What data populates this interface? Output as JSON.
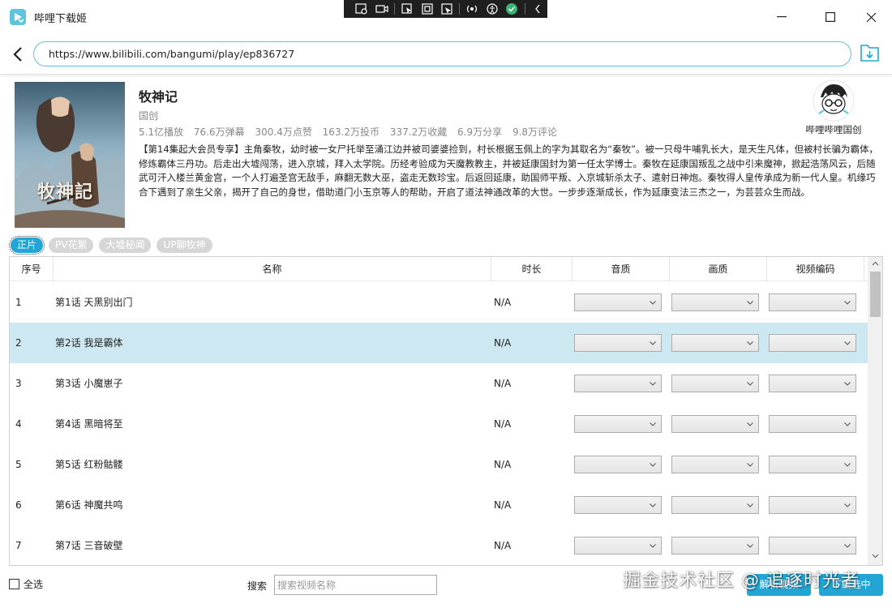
{
  "window": {
    "title": "哔哩下载姬"
  },
  "address": {
    "url": "https://www.bilibili.com/bangumi/play/ep836727"
  },
  "video": {
    "title": "牧神记",
    "type": "国创",
    "stats": [
      "5.1亿播放",
      "76.6万弹幕",
      "300.4万点赞",
      "163.2万投币",
      "337.2万收藏",
      "6.9万分享",
      "9.8万评论"
    ],
    "description": "【第14集起大会员专享】主角秦牧，幼时被一女尸托举至涌江边并被司婆婆捡到，村长根据玉佩上的字为其取名为“秦牧”。被一只母牛哺乳长大，是天生凡体，但被村长骗为霸体，修炼霸体三丹功。后走出大墟闯荡，进入京城，拜入太学院。历经考验成为天魔教教主，并被延康国封为第一任太学博士。秦牧在延康国叛乱之战中引来魔神，掀起浩荡风云，后随武可汗入楼兰黄金宫，一个人打遍圣宫无敌手，麻翻无数大巫，盗走无数珍宝。后返回延康，助国师平叛、入京城斩杀太子、遣射日神炮。秦牧得人皇传承成为新一代人皇。机缘巧合下遇到了亲生父亲，揭开了自己的身世，借助道门小玉京等人的帮助，开启了道法神通改革的大世。一步步逐渐成长，作为延康变法三杰之一，为芸芸众生而战。",
    "cover_text": "牧神記"
  },
  "uploader": {
    "name": "哔哩哔哩国创"
  },
  "tabs": [
    {
      "label": "正片",
      "active": true
    },
    {
      "label": "PV花絮",
      "active": false
    },
    {
      "label": "大墟秘闻",
      "active": false
    },
    {
      "label": "UP聊牧神",
      "active": false
    }
  ],
  "table": {
    "headers": [
      "序号",
      "名称",
      "时长",
      "音质",
      "画质",
      "视频编码"
    ],
    "rows": [
      {
        "no": "1",
        "name": "第1话 天黑别出门",
        "duration": "N/A",
        "selected": false
      },
      {
        "no": "2",
        "name": "第2话 我是霸体",
        "duration": "N/A",
        "selected": true
      },
      {
        "no": "3",
        "name": "第3话 小魔崽子",
        "duration": "N/A",
        "selected": false
      },
      {
        "no": "4",
        "name": "第4话 黑暗将至",
        "duration": "N/A",
        "selected": false
      },
      {
        "no": "5",
        "name": "第5话 红粉骷髅",
        "duration": "N/A",
        "selected": false
      },
      {
        "no": "6",
        "name": "第6话 神魔共鸣",
        "duration": "N/A",
        "selected": false
      },
      {
        "no": "7",
        "name": "第7话 三音破壁",
        "duration": "N/A",
        "selected": false
      }
    ]
  },
  "footer": {
    "select_all": "全选",
    "search_label": "搜索",
    "search_placeholder": "搜索视频名称",
    "parse_button": "解析视频",
    "download_button": "下载选中"
  },
  "watermark": "掘金技术社区 @ 追逐时光者",
  "colors": {
    "accent": "#23a5d3",
    "selected_row": "#cde8f0",
    "url_border": "#5cc2d6"
  }
}
